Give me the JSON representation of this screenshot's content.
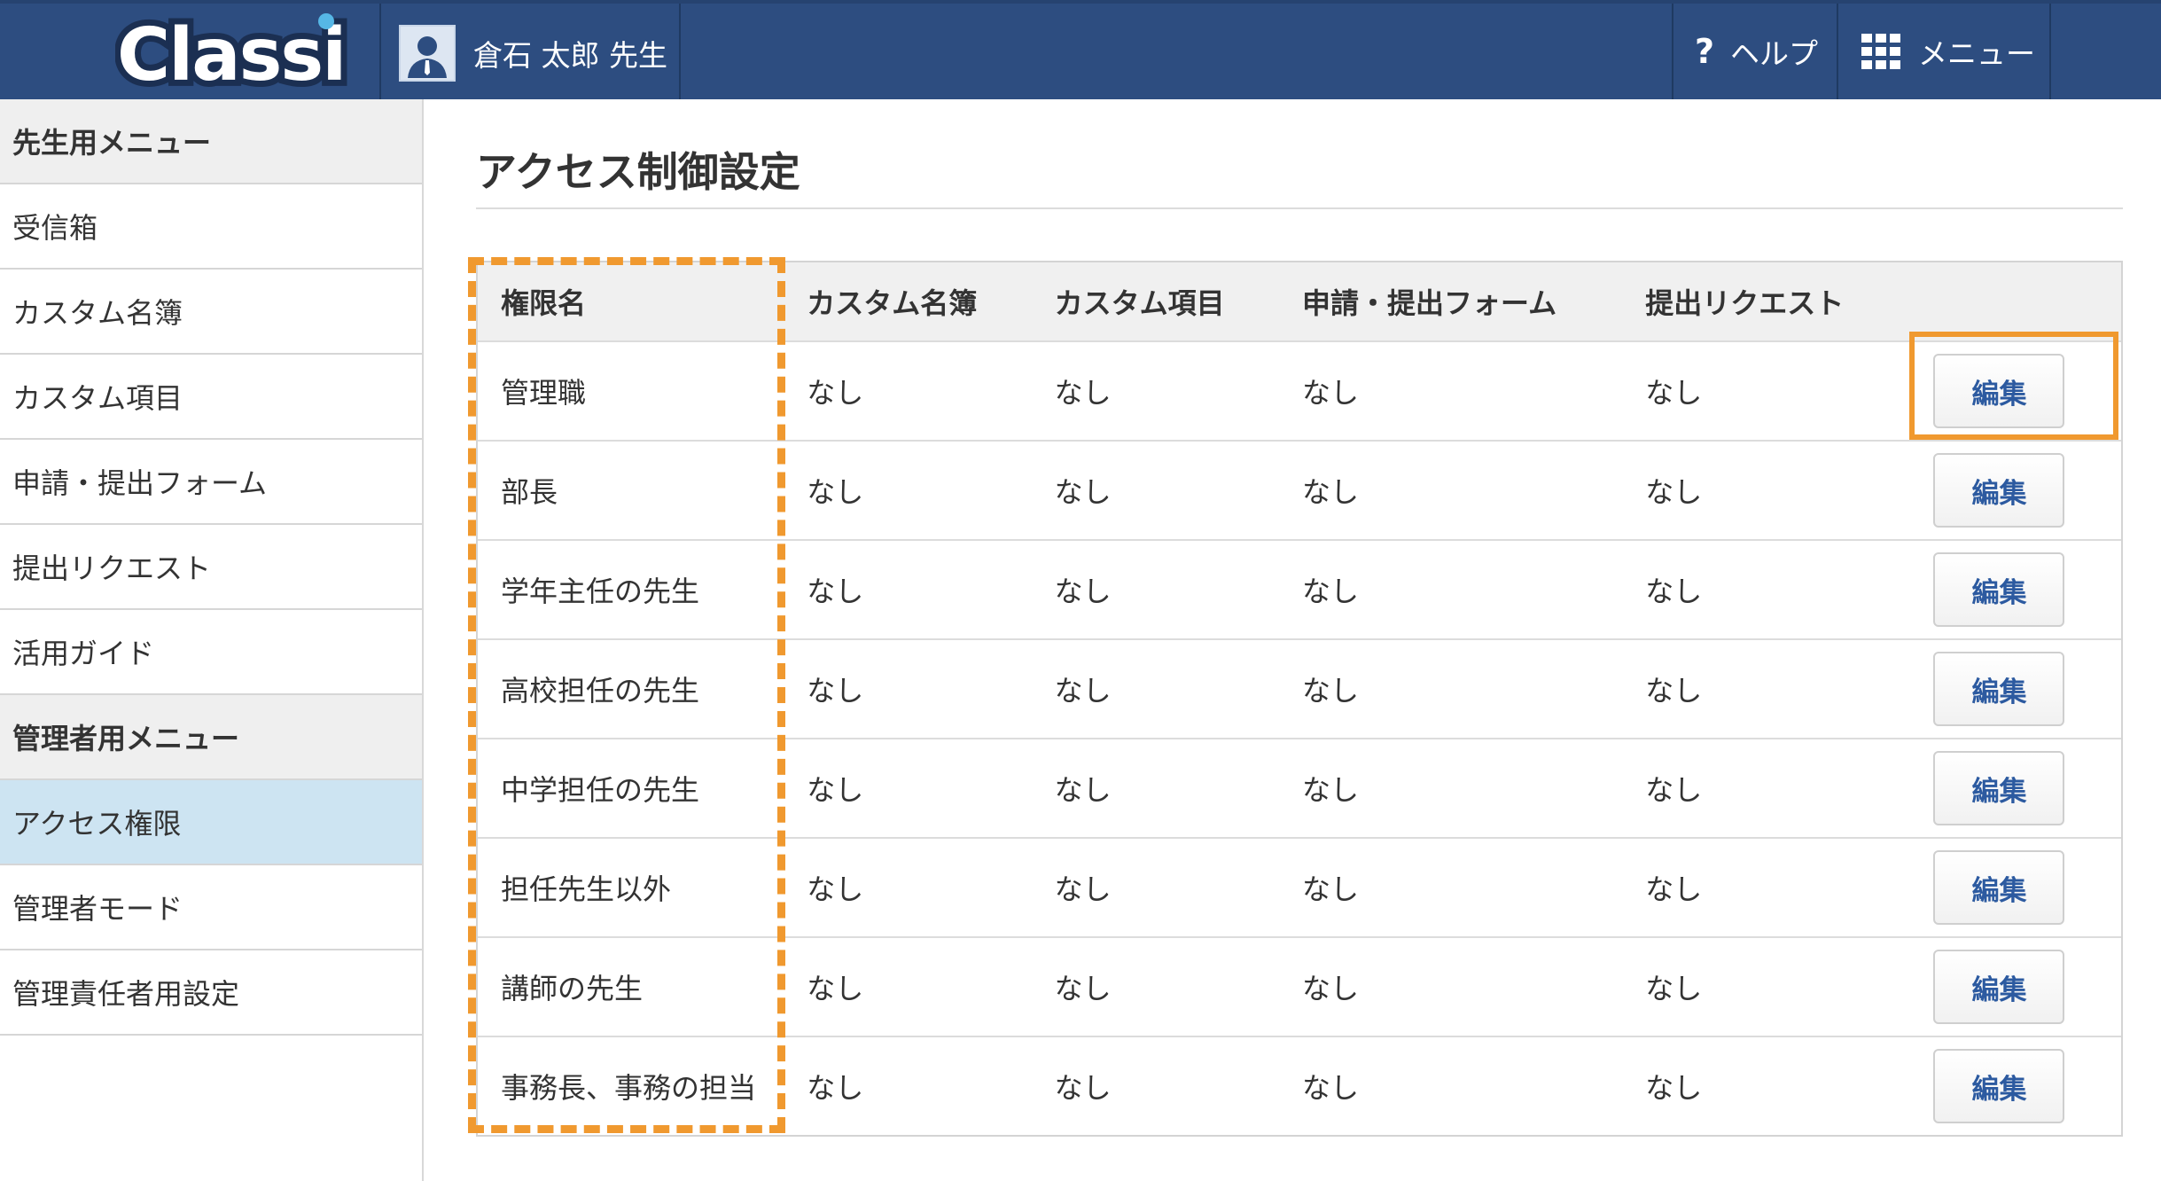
{
  "header": {
    "logo_text": "Classi",
    "user_name": "倉石 太郎 先生",
    "help_label": "ヘルプ",
    "menu_label": "メニュー"
  },
  "sidebar": {
    "items": [
      {
        "label": "先生用メニュー",
        "type": "heading"
      },
      {
        "label": "受信箱",
        "type": "link"
      },
      {
        "label": "カスタム名簿",
        "type": "link"
      },
      {
        "label": "カスタム項目",
        "type": "link"
      },
      {
        "label": "申請・提出フォーム",
        "type": "link"
      },
      {
        "label": "提出リクエスト",
        "type": "link"
      },
      {
        "label": "活用ガイド",
        "type": "link"
      },
      {
        "label": "管理者用メニュー",
        "type": "heading"
      },
      {
        "label": "アクセス権限",
        "type": "active"
      },
      {
        "label": "管理者モード",
        "type": "link"
      },
      {
        "label": "管理責任者用設定",
        "type": "link"
      }
    ]
  },
  "main": {
    "title": "アクセス制御設定",
    "table": {
      "headers": [
        "権限名",
        "カスタム名簿",
        "カスタム項目",
        "申請・提出フォーム",
        "提出リクエスト"
      ],
      "edit_label": "編集",
      "rows": [
        {
          "name": "管理職",
          "a": "なし",
          "b": "なし",
          "c": "なし",
          "d": "なし"
        },
        {
          "name": "部長",
          "a": "なし",
          "b": "なし",
          "c": "なし",
          "d": "なし"
        },
        {
          "name": "学年主任の先生",
          "a": "なし",
          "b": "なし",
          "c": "なし",
          "d": "なし"
        },
        {
          "name": "高校担任の先生",
          "a": "なし",
          "b": "なし",
          "c": "なし",
          "d": "なし"
        },
        {
          "name": "中学担任の先生",
          "a": "なし",
          "b": "なし",
          "c": "なし",
          "d": "なし"
        },
        {
          "name": "担任先生以外",
          "a": "なし",
          "b": "なし",
          "c": "なし",
          "d": "なし"
        },
        {
          "name": "講師の先生",
          "a": "なし",
          "b": "なし",
          "c": "なし",
          "d": "なし"
        },
        {
          "name": "事務長、事務の担当",
          "a": "なし",
          "b": "なし",
          "c": "なし",
          "d": "なし"
        }
      ]
    }
  },
  "colors": {
    "header_bg": "#2d4d80",
    "active_item_bg": "#cde4f2",
    "highlight": "#f0992f",
    "edit_text": "#2c5aa0"
  }
}
